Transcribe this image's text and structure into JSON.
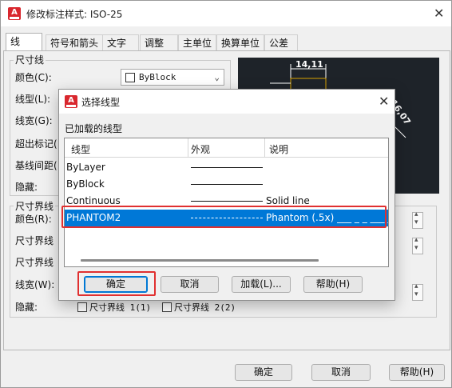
{
  "main": {
    "title": "修改标注样式: ISO-25",
    "tabs": [
      "线",
      "符号和箭头",
      "文字",
      "调整",
      "主单位",
      "换算单位",
      "公差"
    ],
    "dimline_group": "尺寸线",
    "dimline_rows": [
      "颜色(C):",
      "线型(L):",
      "线宽(G):",
      "超出标记(",
      "基线间距(",
      "隐藏:"
    ],
    "color_value": "ByBlock",
    "ext_group": "尺寸界线",
    "ext_rows": [
      "颜色(R):",
      "尺寸界线",
      "尺寸界线",
      "线宽(W):",
      "隐藏:"
    ],
    "suppress_ext1": "尺寸界线 1(1)",
    "suppress_ext2": "尺寸界线 2(2)",
    "preview_dim": "14,11",
    "preview_dim2": "16,07",
    "buttons": {
      "ok": "确定",
      "cancel": "取消",
      "help": "帮助(H)"
    }
  },
  "dialog": {
    "title": "选择线型",
    "section": "已加载的线型",
    "columns": [
      "线型",
      "外观",
      "说明"
    ],
    "rows": [
      {
        "name": "ByLayer",
        "desc": ""
      },
      {
        "name": "ByBlock",
        "desc": ""
      },
      {
        "name": "Continuous",
        "desc": "Solid line"
      },
      {
        "name": "PHANTOM2",
        "desc": "Phantom (.5x) ___ _ _ ___ _"
      }
    ],
    "selected_index": 3,
    "buttons": {
      "ok": "确定",
      "cancel": "取消",
      "load": "加载(L)...",
      "help": "帮助(H)"
    }
  },
  "colors": {
    "highlight": "#0078d7",
    "annotation": "#e03030",
    "preview_bg": "#1e2329",
    "app_icon": "#d9272e"
  },
  "icons": [
    "autocad-app-icon",
    "close-icon",
    "chevron-down-icon",
    "spinner-icon"
  ]
}
